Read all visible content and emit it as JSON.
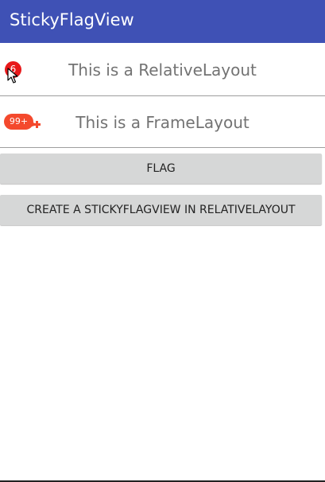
{
  "app": {
    "title": "StickyFlagView",
    "accent_color": "#3f51b5"
  },
  "rows": [
    {
      "label": "This is a RelativeLayout",
      "badge": {
        "text": "6",
        "color": "#e8191b"
      }
    },
    {
      "label": "This is a FrameLayout",
      "badge": {
        "text": "99+",
        "color": "#f4492d"
      }
    }
  ],
  "buttons": {
    "flag": "FLAG",
    "create": "CREATE A STICKYFLAGVIEW IN RELATIVELAYOUT"
  },
  "icons": [
    "cursor-icon",
    "badge-drip-icon"
  ]
}
